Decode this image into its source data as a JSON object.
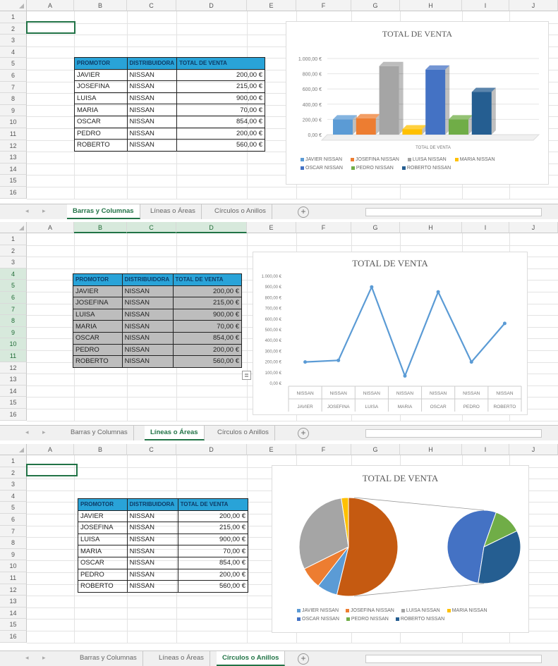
{
  "columns": [
    "A",
    "B",
    "C",
    "D",
    "E",
    "F",
    "G",
    "H",
    "I",
    "J"
  ],
  "rows": [
    "1",
    "2",
    "3",
    "4",
    "5",
    "6",
    "7",
    "8",
    "9",
    "10",
    "11",
    "12",
    "13",
    "14",
    "15",
    "16"
  ],
  "table": {
    "headers": [
      "PROMOTOR",
      "DISTRIBUIDORA",
      "TOTAL DE VENTA"
    ],
    "rows": [
      [
        "JAVIER",
        "NISSAN",
        "200,00 €"
      ],
      [
        "JOSEFINA",
        "NISSAN",
        "215,00 €"
      ],
      [
        "LUISA",
        "NISSAN",
        "900,00 €"
      ],
      [
        "MARIA",
        "NISSAN",
        "70,00 €"
      ],
      [
        "OSCAR",
        "NISSAN",
        "854,00 €"
      ],
      [
        "PEDRO",
        "NISSAN",
        "200,00 €"
      ],
      [
        "ROBERTO",
        "NISSAN",
        "560,00 €"
      ]
    ]
  },
  "tabs": [
    "Barras y Columnas",
    "Líneas o Áreas",
    "Círculos o Anillos"
  ],
  "add_sheet_icon": "plus-circle-icon",
  "colors": {
    "excel_green": "#217346",
    "header_cyan": "#29a3d8",
    "line_blue": "#5b9bd5"
  },
  "chart_data": [
    {
      "type": "bar",
      "variant": "3d-column",
      "title": "TOTAL DE VENTA",
      "xlabel": "TOTAL DE VENTA",
      "y_ticks": [
        "0,00 €",
        "200,00 €",
        "400,00 €",
        "600,00 €",
        "800,00 €",
        "1.000,00 €"
      ],
      "ylim": [
        0,
        1000
      ],
      "categories": [
        "TOTAL DE VENTA"
      ],
      "series": [
        {
          "name": "JAVIER NISSAN",
          "values": [
            200
          ],
          "color": "#5b9bd5"
        },
        {
          "name": "JOSEFINA NISSAN",
          "values": [
            215
          ],
          "color": "#ed7d31"
        },
        {
          "name": "LUISA NISSAN",
          "values": [
            900
          ],
          "color": "#a5a5a5"
        },
        {
          "name": "MARIA NISSAN",
          "values": [
            70
          ],
          "color": "#ffc000"
        },
        {
          "name": "OSCAR NISSAN",
          "values": [
            854
          ],
          "color": "#4472c4"
        },
        {
          "name": "PEDRO NISSAN",
          "values": [
            200
          ],
          "color": "#70ad47"
        },
        {
          "name": "ROBERTO NISSAN",
          "values": [
            560
          ],
          "color": "#255e91"
        }
      ],
      "legend": "bottom"
    },
    {
      "type": "line",
      "title": "TOTAL DE VENTA",
      "y_ticks": [
        "0,00 €",
        "100,00 €",
        "200,00 €",
        "300,00 €",
        "400,00 €",
        "500,00 €",
        "600,00 €",
        "700,00 €",
        "800,00 €",
        "900,00 €",
        "1.000,00 €"
      ],
      "ylim": [
        0,
        1000
      ],
      "categories_top": [
        "NISSAN",
        "NISSAN",
        "NISSAN",
        "NISSAN",
        "NISSAN",
        "NISSAN",
        "NISSAN"
      ],
      "categories": [
        "JAVIER",
        "JOSEFINA",
        "LUISA",
        "MARIA",
        "OSCAR",
        "PEDRO",
        "ROBERTO"
      ],
      "values": [
        200,
        215,
        900,
        70,
        854,
        200,
        560
      ],
      "color": "#5b9bd5"
    },
    {
      "type": "pie",
      "variant": "pie-of-pie",
      "title": "TOTAL DE VENTA",
      "slices": [
        {
          "name": "JAVIER NISSAN",
          "value": 200,
          "color": "#5b9bd5"
        },
        {
          "name": "JOSEFINA NISSAN",
          "value": 215,
          "color": "#ed7d31"
        },
        {
          "name": "LUISA NISSAN",
          "value": 900,
          "color": "#a5a5a5"
        },
        {
          "name": "MARIA NISSAN",
          "value": 70,
          "color": "#ffc000"
        },
        {
          "name": "OSCAR NISSAN",
          "value": 854,
          "color": "#4472c4"
        },
        {
          "name": "PEDRO NISSAN",
          "value": 200,
          "color": "#70ad47"
        },
        {
          "name": "ROBERTO NISSAN",
          "value": 560,
          "color": "#255e91"
        }
      ],
      "legend": "bottom"
    }
  ]
}
